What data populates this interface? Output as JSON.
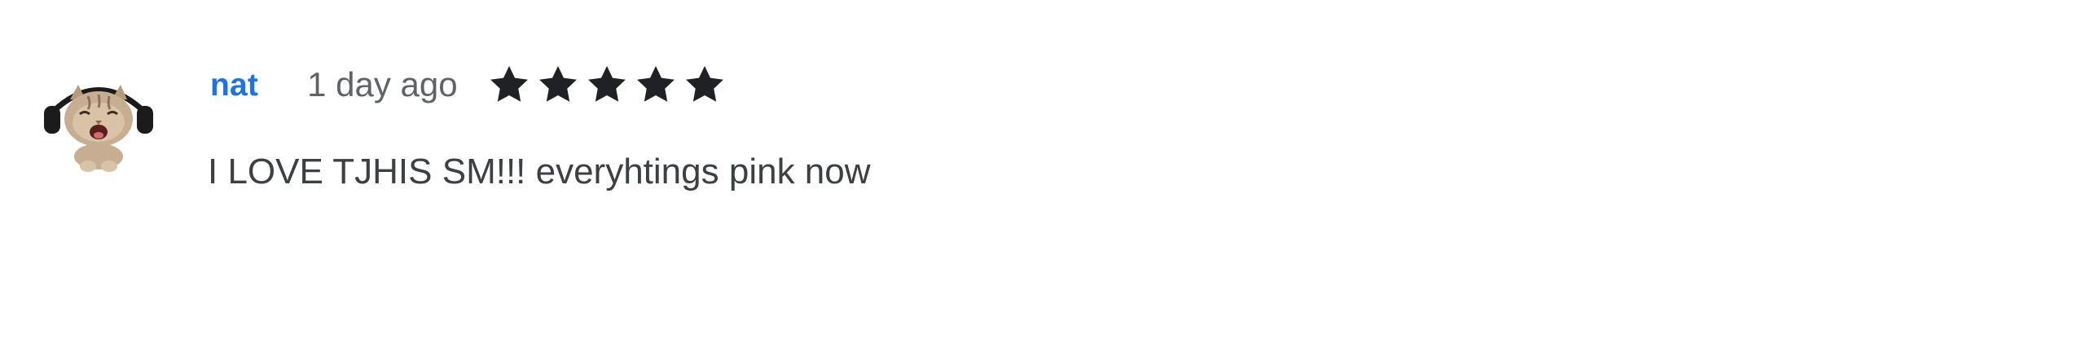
{
  "review": {
    "author": "nat",
    "date": "1 day ago",
    "rating": {
      "value": 5,
      "max": 5,
      "star_color": "#202124",
      "icon": "star-icon"
    },
    "text": "I LOVE TJHIS SM!!! everyhtings pink now",
    "avatar": {
      "icon": "cat-with-headphones-avatar"
    }
  },
  "colors": {
    "author_link": "#1a73e8",
    "date_text": "#5f6368",
    "body_text": "#3c4043",
    "background": "#ffffff"
  }
}
